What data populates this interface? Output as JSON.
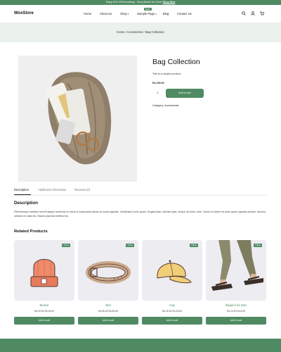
{
  "announcement": {
    "text": "Enjoy 41% Off Everything - Hurry Before Its Gone!",
    "link": "Shop Now"
  },
  "header": {
    "logo": "WoxStore",
    "menu": {
      "home": "Home",
      "about": "About Us",
      "shop": "Shop",
      "new_badge": "NEW",
      "sample_page": "Sample Page",
      "blog": "Blog",
      "contact": "Contact Us"
    },
    "icons": [
      "search-icon",
      "user-icon",
      "cart-icon"
    ]
  },
  "breadcrumb": "Home / Accessories / Bag Collection",
  "product": {
    "title": "Bag Collection",
    "short_description": "This is a simple product.",
    "price": "Rs.199.00",
    "quantity": "1",
    "add_to_cart": "Add to cart",
    "category": "Category: Accessories"
  },
  "tabs": {
    "description": "Description",
    "additional": "Additional information",
    "reviews": "Reviews (0)"
  },
  "description": {
    "heading": "Description",
    "text": "Pellentesque habitant morbi tristique senectus et netus et malesuada fames ac turpis egestas. Vestibulum tortor quam, feugiat vitae, ultricies eget, tempor sit amet, ante. Donec eu libero sit amet quam egestas semper. Aenean ultricies mi vitae est. Mauris placerat eleifend leo."
  },
  "related": {
    "heading": "Related Products",
    "products": [
      {
        "sale": "SALE",
        "name": "Beanie",
        "price": "Rs.20.00 Rs.18.00",
        "button": "Add to cart"
      },
      {
        "sale": "SALE",
        "name": "Belt",
        "price": "Rs.65.00 Rs.55.00",
        "button": "Add to cart"
      },
      {
        "sale": "SALE",
        "name": "Cap",
        "price": "Rs.18.00 Rs.16.00",
        "button": "Add to cart"
      },
      {
        "sale": "SALE",
        "name": "Slippers for Men",
        "price": "Rs.10.00 Rs.8.00",
        "button": "Add to cart"
      }
    ]
  },
  "colors": {
    "accent": "#4f8a63",
    "banner": "#ebf1ed"
  }
}
